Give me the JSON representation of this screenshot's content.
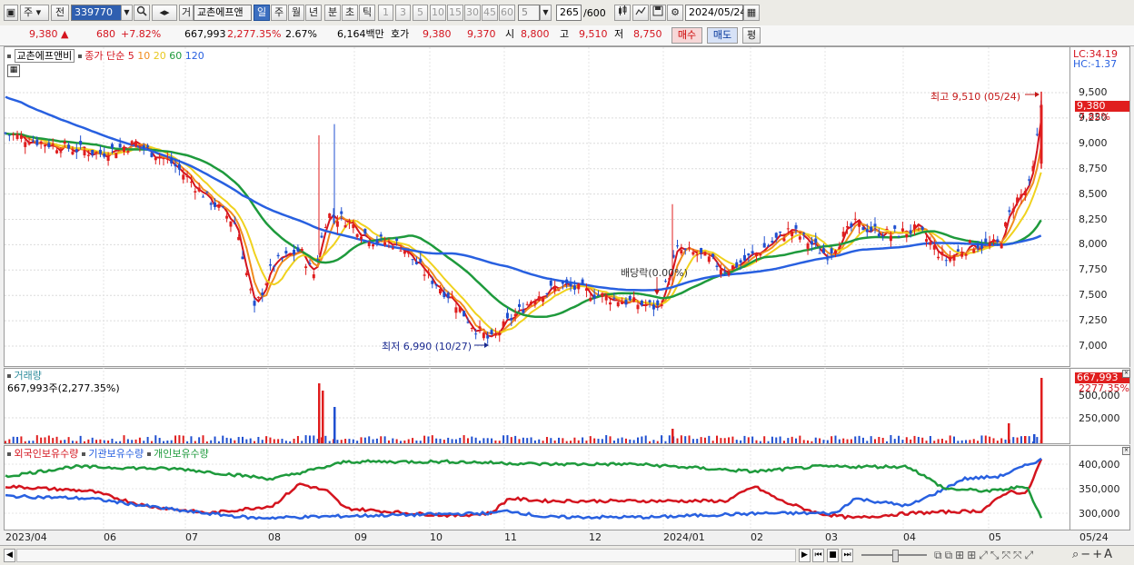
{
  "toolbar": {
    "market": "주",
    "period_all": "전",
    "code": "339770",
    "search_icon": "search-icon",
    "trade_label": "거",
    "stock_name": "교촌에프앤",
    "periods": [
      "일",
      "주",
      "월",
      "년",
      "분",
      "초",
      "틱"
    ],
    "selected_period": "일",
    "intervals": [
      "1",
      "3",
      "5",
      "10",
      "15",
      "30",
      "45",
      "60"
    ],
    "count_value": "5",
    "view_count": "265",
    "view_total": "/600",
    "date": "2024/05/24"
  },
  "quote": {
    "price": "9,380",
    "up_mark": "▲",
    "change": "680",
    "change_pct": "+7.82%",
    "volume": "667,993",
    "volume_pct": "2,277.35%",
    "turnover": "2.67%",
    "amount": "6,164백만",
    "bid_label": "호가",
    "ask": "9,380",
    "bid": "9,370",
    "open_label": "시",
    "open": "8,800",
    "high_label": "고",
    "high": "9,510",
    "low_label": "저",
    "low": "8,750",
    "buy_button": "매수",
    "sell_button": "매도",
    "flat_button": "평"
  },
  "price_panel": {
    "name": "교촌에프앤비",
    "ma_label": "종가 단순",
    "ma_periods": [
      "5",
      "10",
      "20",
      "60",
      "120"
    ],
    "ma_colors": [
      "#d4141e",
      "#f08c1e",
      "#f0d21e",
      "#1e9a3c",
      "#2860e0"
    ],
    "lc_label": "LC:34.19",
    "hc_label": "HC:-1.37",
    "y_ticks": [
      "9,500",
      "9,250",
      "9,000",
      "8,750",
      "8,500",
      "8,250",
      "8,000",
      "7,750",
      "7,500",
      "7,250",
      "7,000"
    ],
    "last_price_tag": "9,380",
    "last_pct_tag": "7.82%",
    "high_note": "최고 9,510 (05/24)",
    "low_note": "최저 6,990 (10/27)",
    "dividend_note": "배당락(0.00%)"
  },
  "volume_panel": {
    "title": "거래량",
    "value": "667,993주(2,277.35%)",
    "y_ticks": [
      "500,000",
      "250,000"
    ],
    "tag_value": "667,993",
    "tag_pct": "2277.35%"
  },
  "holding_panel": {
    "series": [
      "외국인보유수량",
      "기관보유수량",
      "개인보유수량"
    ],
    "colors": [
      "#d4141e",
      "#2860e0",
      "#1e9a3c"
    ],
    "y_ticks": [
      "400,000",
      "350,000",
      "300,000"
    ]
  },
  "x_axis": [
    "2023/04",
    "06",
    "07",
    "08",
    "09",
    "10",
    "11",
    "12",
    "2024/01",
    "02",
    "03",
    "04",
    "05",
    "05/24"
  ],
  "bottom_bar": {
    "icons": [
      "scroll-left-icon",
      "scroll-right-icon",
      "first-icon",
      "stop-icon",
      "last-icon",
      "zoom-icon",
      "zoom-out-icon",
      "zoom-in-icon",
      "text-size-icon"
    ]
  }
}
